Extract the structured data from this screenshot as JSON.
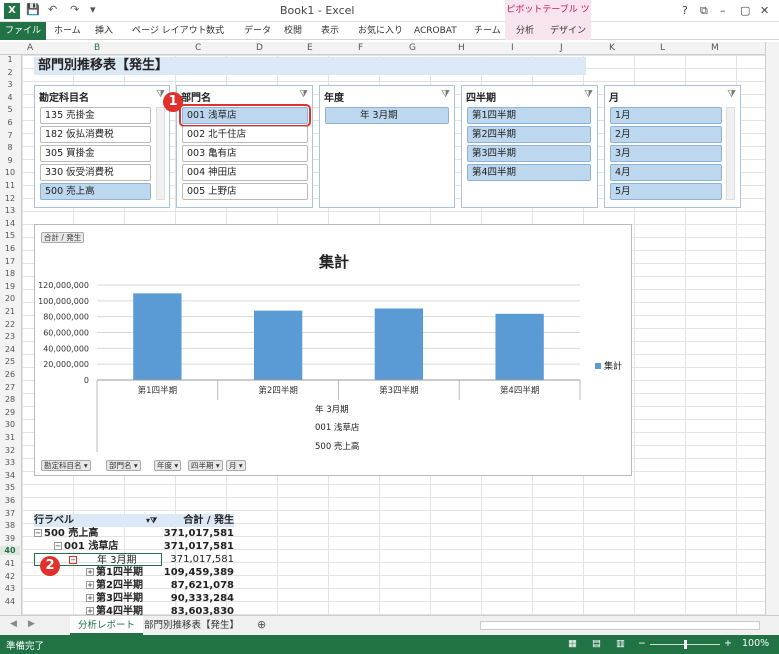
{
  "window": {
    "title": "Book1 - Excel",
    "pivot_tools": "ピボットテーブル ツール",
    "help": "?",
    "controls": [
      "⧉",
      "–",
      "▢",
      "✕"
    ]
  },
  "ribbon": {
    "tabs": [
      "ファイル",
      "ホーム",
      "挿入",
      "ページ レイアウト",
      "数式",
      "データ",
      "校閲",
      "表示",
      "お気に入り",
      "ACROBAT",
      "チーム",
      "分析",
      "デザイン"
    ]
  },
  "columns": [
    "A",
    "B",
    "C",
    "D",
    "E",
    "F",
    "G",
    "H",
    "I",
    "J",
    "K",
    "L",
    "M"
  ],
  "rows": [
    "1",
    "2",
    "3",
    "4",
    "5",
    "6",
    "7",
    "8",
    "9",
    "10",
    "11",
    "12",
    "13",
    "14",
    "15",
    "16",
    "17",
    "18",
    "19",
    "20",
    "21",
    "22",
    "23",
    "24",
    "25",
    "26",
    "27",
    "28",
    "29",
    "30",
    "31",
    "32",
    "33",
    "34",
    "35",
    "36",
    "37",
    "38",
    "39",
    "40",
    "41",
    "42",
    "43",
    "44"
  ],
  "sheet": {
    "title": "部門別推移表【発生】"
  },
  "slicers": [
    {
      "header": "勘定科目名",
      "items": [
        "135 売掛金",
        "182 仮払消費税",
        "305 買掛金",
        "330 仮受消費税",
        "500 売上高"
      ]
    },
    {
      "header": "部門名",
      "items": [
        "001 浅草店",
        "002 北千住店",
        "003 亀有店",
        "004 神田店",
        "005 上野店"
      ]
    },
    {
      "header": "年度",
      "items": [
        "年 3月期"
      ]
    },
    {
      "header": "四半期",
      "items": [
        "第1四半期",
        "第2四半期",
        "第3四半期",
        "第4四半期"
      ]
    },
    {
      "header": "月",
      "items": [
        "1月",
        "2月",
        "3月",
        "4月",
        "5月"
      ]
    }
  ],
  "chart": {
    "field_button": "合計 / 発生",
    "filter_buttons": [
      "勘定科目名",
      "部門名",
      "年度",
      "四半期",
      "月"
    ],
    "info_lines": [
      "年 3月期",
      "001 浅草店",
      "500 売上高"
    ],
    "legend": "集計",
    "accent": "#5b9bd5"
  },
  "chart_data": {
    "type": "bar",
    "title": "集計",
    "categories": [
      "第1四半期",
      "第2四半期",
      "第3四半期",
      "第4四半期"
    ],
    "series": [
      {
        "name": "集計",
        "values": [
          109459389,
          87621078,
          90333284,
          83603830
        ]
      }
    ],
    "y_ticks": [
      "120,000,000",
      "100,000,000",
      "80,000,000",
      "60,000,000",
      "40,000,000",
      "20,000,000",
      "0"
    ],
    "ylim": [
      0,
      120000000
    ],
    "grid": true,
    "legend_position": "right"
  },
  "pivot": {
    "header_label": "行ラベル",
    "header_value": "合計 / 発生",
    "rows": [
      {
        "label": "500 売上高",
        "value": "371,017,581"
      },
      {
        "label": "001 浅草店",
        "value": "371,017,581"
      },
      {
        "label": "年 3月期",
        "value": "371,017,581"
      },
      {
        "label": "第1四半期",
        "value": "109,459,389"
      },
      {
        "label": "第2四半期",
        "value": "87,621,078"
      },
      {
        "label": "第3四半期",
        "value": "90,333,284"
      },
      {
        "label": "第4四半期",
        "value": "83,603,830"
      }
    ]
  },
  "badges": [
    "1",
    "2"
  ],
  "sheettabs": [
    "分析レポート",
    "部門別推移表【発生】"
  ],
  "status": {
    "text": "準備完了",
    "zoom": "100%"
  }
}
